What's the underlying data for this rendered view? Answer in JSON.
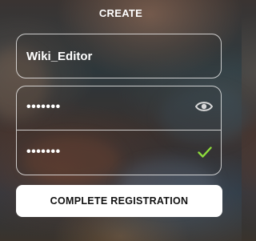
{
  "header": {
    "title": "CREATE"
  },
  "form": {
    "username_value": "Wiki_Editor",
    "password_value": "•••••••",
    "confirm_password_value": "•••••••",
    "show_password_icon": "eye-icon",
    "match_icon": "check-icon",
    "match_color": "#8ddc3c",
    "submit_label": "COMPLETE REGISTRATION"
  }
}
